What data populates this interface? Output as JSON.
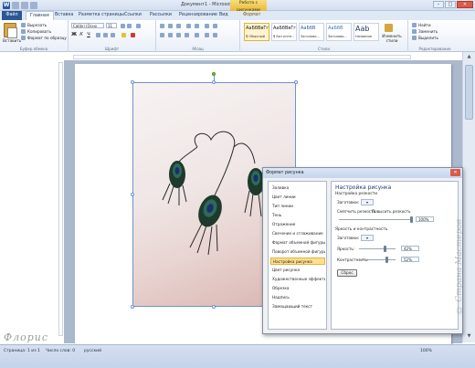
{
  "window": {
    "title": "Документ1 - Microsoft Word",
    "context_tab_title": "Работа с рисунками",
    "controls": {
      "minimize": "–",
      "maximize": "□",
      "close": "✕"
    }
  },
  "tabs": [
    {
      "label": "Файл"
    },
    {
      "label": "Главная"
    },
    {
      "label": "Вставка"
    },
    {
      "label": "Разметка страницы"
    },
    {
      "label": "Ссылки"
    },
    {
      "label": "Рассылки"
    },
    {
      "label": "Рецензирование"
    },
    {
      "label": "Вид"
    },
    {
      "label": "Формат"
    }
  ],
  "ribbon": {
    "clipboard": {
      "paste": "Вставить",
      "cut": "Вырезать",
      "copy": "Копировать",
      "format_painter": "Формат по образцу",
      "group_label": "Буфер обмена"
    },
    "font": {
      "font_name": "Calibri (Осно",
      "font_size": "11",
      "bold": "Ж",
      "italic": "К",
      "underline": "Ч",
      "group_label": "Шрифт"
    },
    "paragraph": {
      "group_label": "Абзац"
    },
    "styles": {
      "items": [
        {
          "sample": "АаБбВвГг",
          "name": "¶ Обычный"
        },
        {
          "sample": "АаБбВвГг",
          "name": "¶ Без инте..."
        },
        {
          "sample": "АаБбВ",
          "name": "Заголово..."
        },
        {
          "sample": "АаБбВ",
          "name": "Заголово..."
        },
        {
          "sample": "Aab",
          "name": "Название"
        }
      ],
      "change_styles": "Изменить стили",
      "group_label": "Стили"
    },
    "editing": {
      "find": "Найти",
      "replace": "Заменить",
      "select": "Выделить",
      "group_label": "Редактирование"
    }
  },
  "dialog": {
    "title": "Формат рисунка",
    "close": "✕",
    "categories": [
      "Заливка",
      "Цвет линии",
      "Тип линии",
      "Тень",
      "Отражение",
      "Свечение и сглаживание",
      "Формат объемной фигуры",
      "Поворот объемной фигуры",
      "Настройка рисунка",
      "Цвет рисунка",
      "Художественные эффекты",
      "Обрезка",
      "Надпись",
      "Замещающий текст"
    ],
    "selected_index": 8,
    "panel": {
      "heading": "Настройка рисунка",
      "sharpness_section": "Настройка резкости",
      "presets_label": "Заготовки:",
      "soften_label": "Смягчить резкость",
      "sharpen_label": "Повысить резкость",
      "sharpness_value": "100%",
      "brightness_contrast_section": "Яркость и контрастность",
      "bc_presets_label": "Заготовки:",
      "brightness_label": "Яркость:",
      "brightness_value": "42%",
      "brightness_level": 0.71,
      "contrast_label": "Контрастность:",
      "contrast_value": "52%",
      "contrast_level": 0.76,
      "reset_button": "Сброс"
    }
  },
  "statusbar": {
    "page": "Страница: 1 из 1",
    "words": "Число слов: 0",
    "language": "русский",
    "zoom": "100%"
  },
  "watermarks": {
    "left": "Флорис",
    "right": "© Страна Мастеров"
  }
}
